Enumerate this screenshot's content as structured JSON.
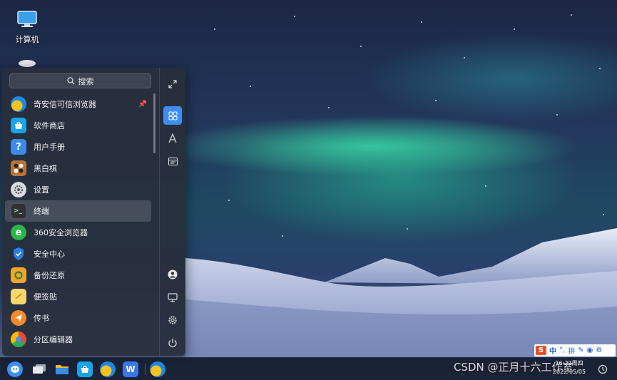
{
  "desktop": {
    "icons": [
      {
        "label": "计算机",
        "icon": "computer-icon"
      },
      {
        "label": "",
        "icon": "trash-icon"
      }
    ]
  },
  "start_menu": {
    "search_label": "搜索",
    "apps": [
      {
        "label": "奇安信可信浏览器",
        "icon": "qianxin-browser-icon",
        "color": "#f2b21b",
        "pinned": true
      },
      {
        "label": "软件商店",
        "icon": "software-store-icon",
        "color": "#1aa4e8"
      },
      {
        "label": "用户手册",
        "icon": "user-manual-icon",
        "color": "#3f8ae8"
      },
      {
        "label": "黑白棋",
        "icon": "reversi-icon",
        "color": "#b8743a"
      },
      {
        "label": "设置",
        "icon": "settings-icon",
        "color": "#9aa0a8"
      },
      {
        "label": "终端",
        "icon": "terminal-icon",
        "color": "#2f3136",
        "active": true
      },
      {
        "label": "360安全浏览器",
        "icon": "360-browser-icon",
        "color": "#2db34a"
      },
      {
        "label": "安全中心",
        "icon": "security-center-icon",
        "color": "#2c7fe0"
      },
      {
        "label": "备份还原",
        "icon": "backup-restore-icon",
        "color": "#f0a62b"
      },
      {
        "label": "便签贴",
        "icon": "sticky-notes-icon",
        "color": "#f5c43a"
      },
      {
        "label": "传书",
        "icon": "chuanshu-icon",
        "color": "#f08a2c"
      },
      {
        "label": "分区编辑器",
        "icon": "partition-editor-icon",
        "color": "#e54b3c"
      }
    ],
    "side_icons": [
      "expand-icon",
      "all-apps-icon",
      "alphabet-sort-icon",
      "category-sort-icon",
      "user-icon",
      "computer-icon",
      "settings-icon",
      "power-icon"
    ]
  },
  "taskbar": {
    "icons": [
      "start-menu-icon",
      "multitask-view-icon",
      "file-manager-icon",
      "software-store-icon",
      "qianxin-browser-icon",
      "wps-icon",
      "qianxin-browser-running-icon"
    ],
    "clock_time": "16:27周四",
    "clock_date": "2022/05/05"
  },
  "ime": {
    "mode": "中",
    "punct": "°,",
    "pinyin": "拼"
  },
  "watermark": "CSDN @正月十六工作室"
}
